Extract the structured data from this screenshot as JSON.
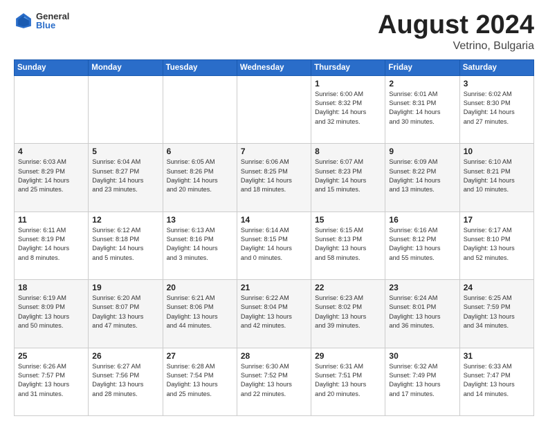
{
  "logo": {
    "general": "General",
    "blue": "Blue"
  },
  "title": {
    "month_year": "August 2024",
    "location": "Vetrino, Bulgaria"
  },
  "weekdays": [
    "Sunday",
    "Monday",
    "Tuesday",
    "Wednesday",
    "Thursday",
    "Friday",
    "Saturday"
  ],
  "weeks": [
    [
      {
        "day": "",
        "info": ""
      },
      {
        "day": "",
        "info": ""
      },
      {
        "day": "",
        "info": ""
      },
      {
        "day": "",
        "info": ""
      },
      {
        "day": "1",
        "info": "Sunrise: 6:00 AM\nSunset: 8:32 PM\nDaylight: 14 hours\nand 32 minutes."
      },
      {
        "day": "2",
        "info": "Sunrise: 6:01 AM\nSunset: 8:31 PM\nDaylight: 14 hours\nand 30 minutes."
      },
      {
        "day": "3",
        "info": "Sunrise: 6:02 AM\nSunset: 8:30 PM\nDaylight: 14 hours\nand 27 minutes."
      }
    ],
    [
      {
        "day": "4",
        "info": "Sunrise: 6:03 AM\nSunset: 8:29 PM\nDaylight: 14 hours\nand 25 minutes."
      },
      {
        "day": "5",
        "info": "Sunrise: 6:04 AM\nSunset: 8:27 PM\nDaylight: 14 hours\nand 23 minutes."
      },
      {
        "day": "6",
        "info": "Sunrise: 6:05 AM\nSunset: 8:26 PM\nDaylight: 14 hours\nand 20 minutes."
      },
      {
        "day": "7",
        "info": "Sunrise: 6:06 AM\nSunset: 8:25 PM\nDaylight: 14 hours\nand 18 minutes."
      },
      {
        "day": "8",
        "info": "Sunrise: 6:07 AM\nSunset: 8:23 PM\nDaylight: 14 hours\nand 15 minutes."
      },
      {
        "day": "9",
        "info": "Sunrise: 6:09 AM\nSunset: 8:22 PM\nDaylight: 14 hours\nand 13 minutes."
      },
      {
        "day": "10",
        "info": "Sunrise: 6:10 AM\nSunset: 8:21 PM\nDaylight: 14 hours\nand 10 minutes."
      }
    ],
    [
      {
        "day": "11",
        "info": "Sunrise: 6:11 AM\nSunset: 8:19 PM\nDaylight: 14 hours\nand 8 minutes."
      },
      {
        "day": "12",
        "info": "Sunrise: 6:12 AM\nSunset: 8:18 PM\nDaylight: 14 hours\nand 5 minutes."
      },
      {
        "day": "13",
        "info": "Sunrise: 6:13 AM\nSunset: 8:16 PM\nDaylight: 14 hours\nand 3 minutes."
      },
      {
        "day": "14",
        "info": "Sunrise: 6:14 AM\nSunset: 8:15 PM\nDaylight: 14 hours\nand 0 minutes."
      },
      {
        "day": "15",
        "info": "Sunrise: 6:15 AM\nSunset: 8:13 PM\nDaylight: 13 hours\nand 58 minutes."
      },
      {
        "day": "16",
        "info": "Sunrise: 6:16 AM\nSunset: 8:12 PM\nDaylight: 13 hours\nand 55 minutes."
      },
      {
        "day": "17",
        "info": "Sunrise: 6:17 AM\nSunset: 8:10 PM\nDaylight: 13 hours\nand 52 minutes."
      }
    ],
    [
      {
        "day": "18",
        "info": "Sunrise: 6:19 AM\nSunset: 8:09 PM\nDaylight: 13 hours\nand 50 minutes."
      },
      {
        "day": "19",
        "info": "Sunrise: 6:20 AM\nSunset: 8:07 PM\nDaylight: 13 hours\nand 47 minutes."
      },
      {
        "day": "20",
        "info": "Sunrise: 6:21 AM\nSunset: 8:06 PM\nDaylight: 13 hours\nand 44 minutes."
      },
      {
        "day": "21",
        "info": "Sunrise: 6:22 AM\nSunset: 8:04 PM\nDaylight: 13 hours\nand 42 minutes."
      },
      {
        "day": "22",
        "info": "Sunrise: 6:23 AM\nSunset: 8:02 PM\nDaylight: 13 hours\nand 39 minutes."
      },
      {
        "day": "23",
        "info": "Sunrise: 6:24 AM\nSunset: 8:01 PM\nDaylight: 13 hours\nand 36 minutes."
      },
      {
        "day": "24",
        "info": "Sunrise: 6:25 AM\nSunset: 7:59 PM\nDaylight: 13 hours\nand 34 minutes."
      }
    ],
    [
      {
        "day": "25",
        "info": "Sunrise: 6:26 AM\nSunset: 7:57 PM\nDaylight: 13 hours\nand 31 minutes."
      },
      {
        "day": "26",
        "info": "Sunrise: 6:27 AM\nSunset: 7:56 PM\nDaylight: 13 hours\nand 28 minutes."
      },
      {
        "day": "27",
        "info": "Sunrise: 6:28 AM\nSunset: 7:54 PM\nDaylight: 13 hours\nand 25 minutes."
      },
      {
        "day": "28",
        "info": "Sunrise: 6:30 AM\nSunset: 7:52 PM\nDaylight: 13 hours\nand 22 minutes."
      },
      {
        "day": "29",
        "info": "Sunrise: 6:31 AM\nSunset: 7:51 PM\nDaylight: 13 hours\nand 20 minutes."
      },
      {
        "day": "30",
        "info": "Sunrise: 6:32 AM\nSunset: 7:49 PM\nDaylight: 13 hours\nand 17 minutes."
      },
      {
        "day": "31",
        "info": "Sunrise: 6:33 AM\nSunset: 7:47 PM\nDaylight: 13 hours\nand 14 minutes."
      }
    ]
  ]
}
